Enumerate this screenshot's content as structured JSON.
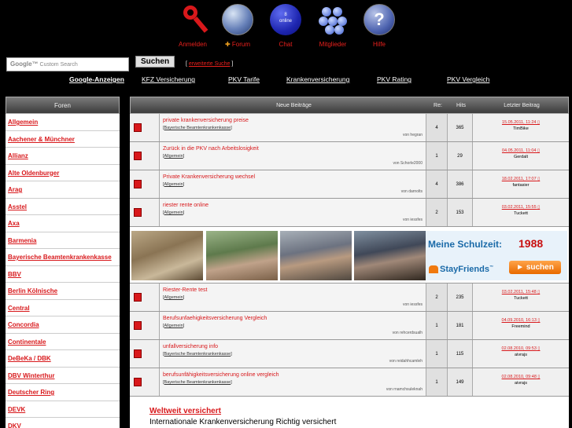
{
  "nav": [
    {
      "label": "Anmelden",
      "icon": "key-icon"
    },
    {
      "label": "Forum",
      "icon": "globe-icon",
      "prefix": "✚"
    },
    {
      "label": "Chat",
      "icon": "chat-icon",
      "badge": "8\nonline"
    },
    {
      "label": "Mitglieder",
      "icon": "members-icon"
    },
    {
      "label": "Hilfe",
      "icon": "help-icon",
      "glyph": "?"
    }
  ],
  "search": {
    "brand": "Google™",
    "placeholder": "Custom Search",
    "button": "Suchen",
    "advanced": "erweiterte Suche"
  },
  "adlinks": [
    "Google-Anzeigen",
    "KFZ Versicherung",
    "PKV Tarife",
    "Krankenversicherung",
    "PKV Rating",
    "PKV Vergleich"
  ],
  "sidebar": {
    "header": "Foren",
    "items": [
      "Allgemein",
      "Aachener & Münchner",
      "Allianz",
      "Alte Oldenburger",
      "Arag",
      "Asstel",
      "Axa",
      "Barmenia",
      "Bayerische Beamtenkrankenkasse",
      "BBV",
      "Berlin Kölnische",
      "Central",
      "Concordia",
      "Continentale",
      "DeBeKa / DBK",
      "DBV Winterthur",
      "Deutscher Ring",
      "DEVK",
      "DKV"
    ]
  },
  "table": {
    "headers": {
      "topic": "Neue Beiträge",
      "re": "Re:",
      "hits": "Hits",
      "last": "Letzter Beitrag"
    },
    "rows_top": [
      {
        "title": "private krankenversicherung preise",
        "forum": "Bayerische Beamtenkrankenkasse",
        "by": "von hegran",
        "re": "4",
        "hits": "365",
        "date": "15.05.2011, 11:24",
        "user": "TimBike"
      },
      {
        "title": "Zurück in die PKV nach Arbeitslosigkeit",
        "forum": "Allgemein",
        "by": "von Schorle2000",
        "re": "1",
        "hits": "29",
        "date": "04.05.2011, 11:04",
        "user": "Gerdalt"
      },
      {
        "title": "Private Krankenversicherung wechsel",
        "forum": "Allgemein",
        "by": "von darnolts",
        "re": "4",
        "hits": "386",
        "date": "18.02.2011, 17:07",
        "user": "fantasier"
      },
      {
        "title": "riester rente online",
        "forum": "Allgemein",
        "by": "von iessfes",
        "re": "2",
        "hits": "153",
        "date": "03.02.2011, 15:55",
        "user": "Tuckett"
      }
    ],
    "rows_bottom": [
      {
        "title": "Riester-Rente test",
        "forum": "Allgemein",
        "by": "von iessfes",
        "re": "2",
        "hits": "235",
        "date": "03.02.2011, 15:48",
        "user": "Tuckett"
      },
      {
        "title": "Berufsunfaehigkeitsversicherung Vergleich",
        "forum": "Allgemein",
        "by": "von rehcerdsualh",
        "re": "1",
        "hits": "181",
        "date": "04.09.2010, 16:13",
        "user": "Freemind"
      },
      {
        "title": "unfallversicherung info",
        "forum": "Bayerische Beamtenkrankenkasse",
        "by": "von reidahhcamleh",
        "re": "1",
        "hits": "115",
        "date": "02.08.2010, 09:53",
        "user": "aivrajs"
      },
      {
        "title": "berufsunfähigkeitsversicherung online vergleich",
        "forum": "Bayerische Beamtenkrankenkasse",
        "by": "von rnamchsuleknah",
        "re": "1",
        "hits": "149",
        "date": "02.08.2010, 09:48",
        "user": "aivrajs"
      }
    ]
  },
  "banner": {
    "school_label": "Meine Schulzeit:",
    "year": "1988",
    "brand": "StayFriends",
    "brand_tm": "™",
    "button": "suchen"
  },
  "bottom_ad": {
    "title": "Weltweit versichert",
    "text": "Internationale Krankenversicherung Richtig versichert"
  },
  "colors": {
    "accent": "#d8181b",
    "header_bg": "#4a4a4a",
    "page_bg": "#000000"
  }
}
